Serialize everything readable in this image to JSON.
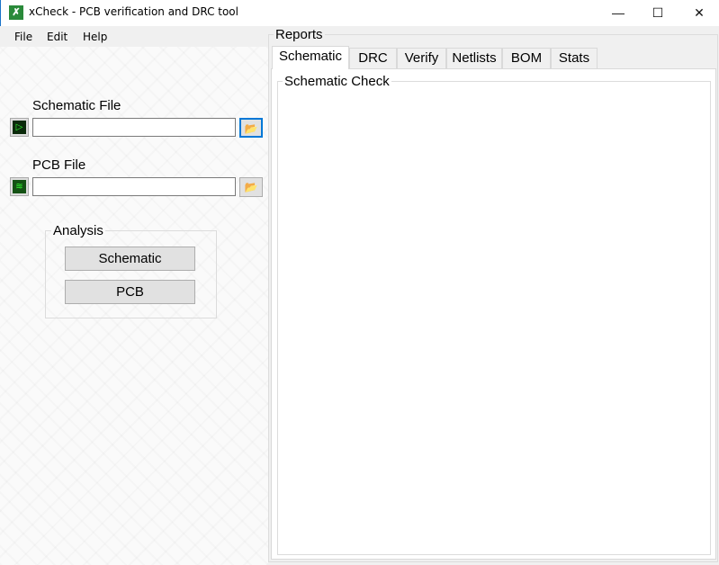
{
  "window": {
    "title": "xCheck - PCB verification and DRC tool",
    "minimize": "—",
    "maximize": "☐",
    "close": "✕",
    "app_icon": "xcheck-logo"
  },
  "menu": [
    "File",
    "Edit",
    "Help"
  ],
  "left": {
    "schematic_label": "Schematic File",
    "schematic_value": "",
    "schematic_icon": "schematic-icon",
    "pcb_label": "PCB File",
    "pcb_value": "",
    "pcb_icon": "pcb-icon",
    "browse_icon": "📂",
    "analysis_label": "Analysis",
    "buttons": [
      "Schematic",
      "PCB"
    ]
  },
  "reports": {
    "label": "Reports",
    "tabs": [
      "Schematic",
      "DRC",
      "Verify",
      "Netlists",
      "BOM",
      "Stats"
    ],
    "active_tab": "Schematic",
    "group_label": "Schematic Check"
  }
}
